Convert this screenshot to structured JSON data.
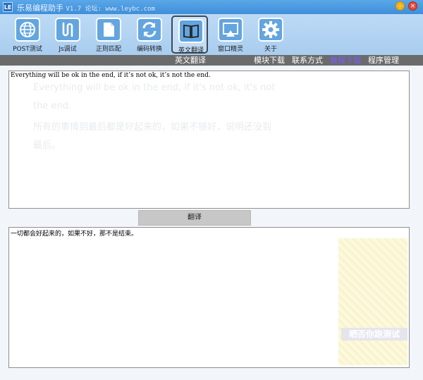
{
  "window": {
    "app_icon": "LE",
    "title": "乐易编程助手",
    "version_forum": "V1.7 论坛: www.leybc.com",
    "minimize_glyph": "–",
    "close_glyph": "×"
  },
  "toolbar": {
    "tools": [
      {
        "label": "POST测试",
        "icon": "globe-icon"
      },
      {
        "label": "Js调试",
        "icon": "brackets-icon"
      },
      {
        "label": "正则匹配",
        "icon": "document-icon"
      },
      {
        "label": "编码转换",
        "icon": "refresh-icon"
      },
      {
        "label": "英文翻译",
        "icon": "book-icon"
      },
      {
        "label": "窗口精灵",
        "icon": "window-icon"
      },
      {
        "label": "关于",
        "icon": "gear-icon"
      }
    ],
    "active_index": 4
  },
  "menu": {
    "current": "英文翻译",
    "links": [
      "模块下载",
      "联系方式",
      "教程下载",
      "程序管理"
    ],
    "highlight_link": "教程下载"
  },
  "translator": {
    "source_text": "Everything will be ok in the end, if it’s not ok, it’s not the end.",
    "translate_label": "翻译",
    "result_text": "一切都会好起来的，如果不好，那不是结束。"
  },
  "ghost": {
    "line1": "Everything will be ok in the end, if it's not ok, it's not",
    "line2": "the end.",
    "line3": "所有的事情到最后都是好起来的，如果不够好，说明还没到",
    "line4": "最后。",
    "ad": "晒否你跑测试"
  },
  "colors": {
    "titlebar": "#4a9be3",
    "toolbar": "#b4d4f2",
    "menustrip": "#6b6b6b",
    "highlight": "#7a5cff"
  }
}
